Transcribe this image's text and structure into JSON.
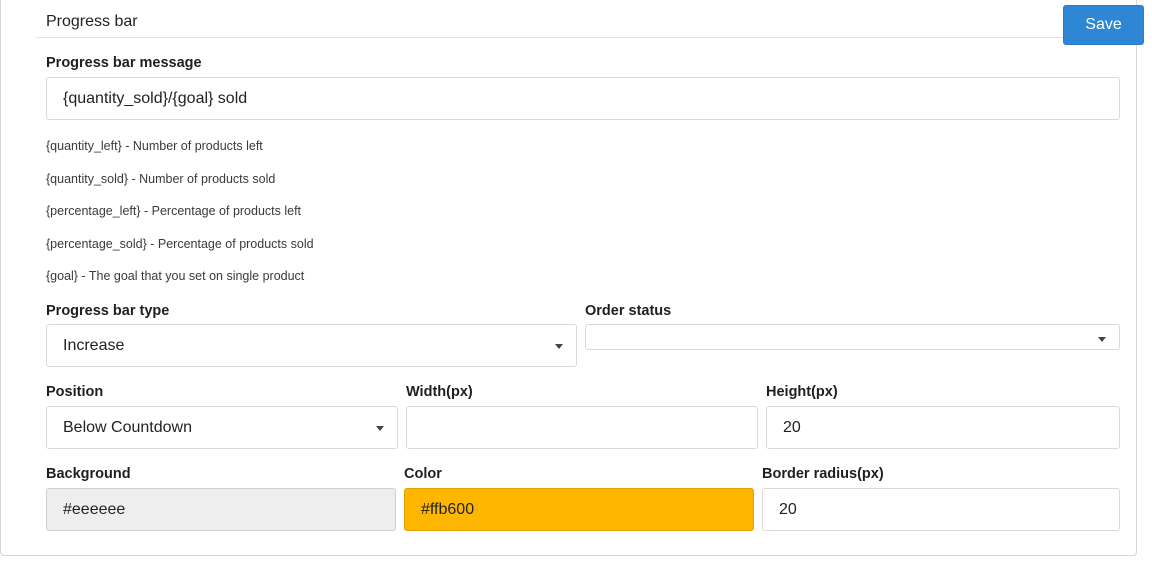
{
  "header": {
    "title": "Progress bar",
    "save_label": "Save"
  },
  "message": {
    "label": "Progress bar message",
    "value": "{quantity_sold}/{goal} sold"
  },
  "help_lines": [
    "{quantity_left} - Number of products left",
    "{quantity_sold} - Number of products sold",
    "{percentage_left} - Percentage of products left",
    "{percentage_sold} - Percentage of products sold",
    "{goal} - The goal that you set on single product"
  ],
  "type": {
    "label": "Progress bar type",
    "value": "Increase"
  },
  "order_status": {
    "label": "Order status",
    "value": ""
  },
  "position": {
    "label": "Position",
    "value": "Below Countdown"
  },
  "width": {
    "label": "Width(px)",
    "value": ""
  },
  "height": {
    "label": "Height(px)",
    "value": "20"
  },
  "background": {
    "label": "Background",
    "value": "#eeeeee",
    "color": "#eeeeee"
  },
  "color": {
    "label": "Color",
    "value": "#ffb600",
    "color": "#ffb600"
  },
  "border_radius": {
    "label": "Border radius(px)",
    "value": "20"
  }
}
